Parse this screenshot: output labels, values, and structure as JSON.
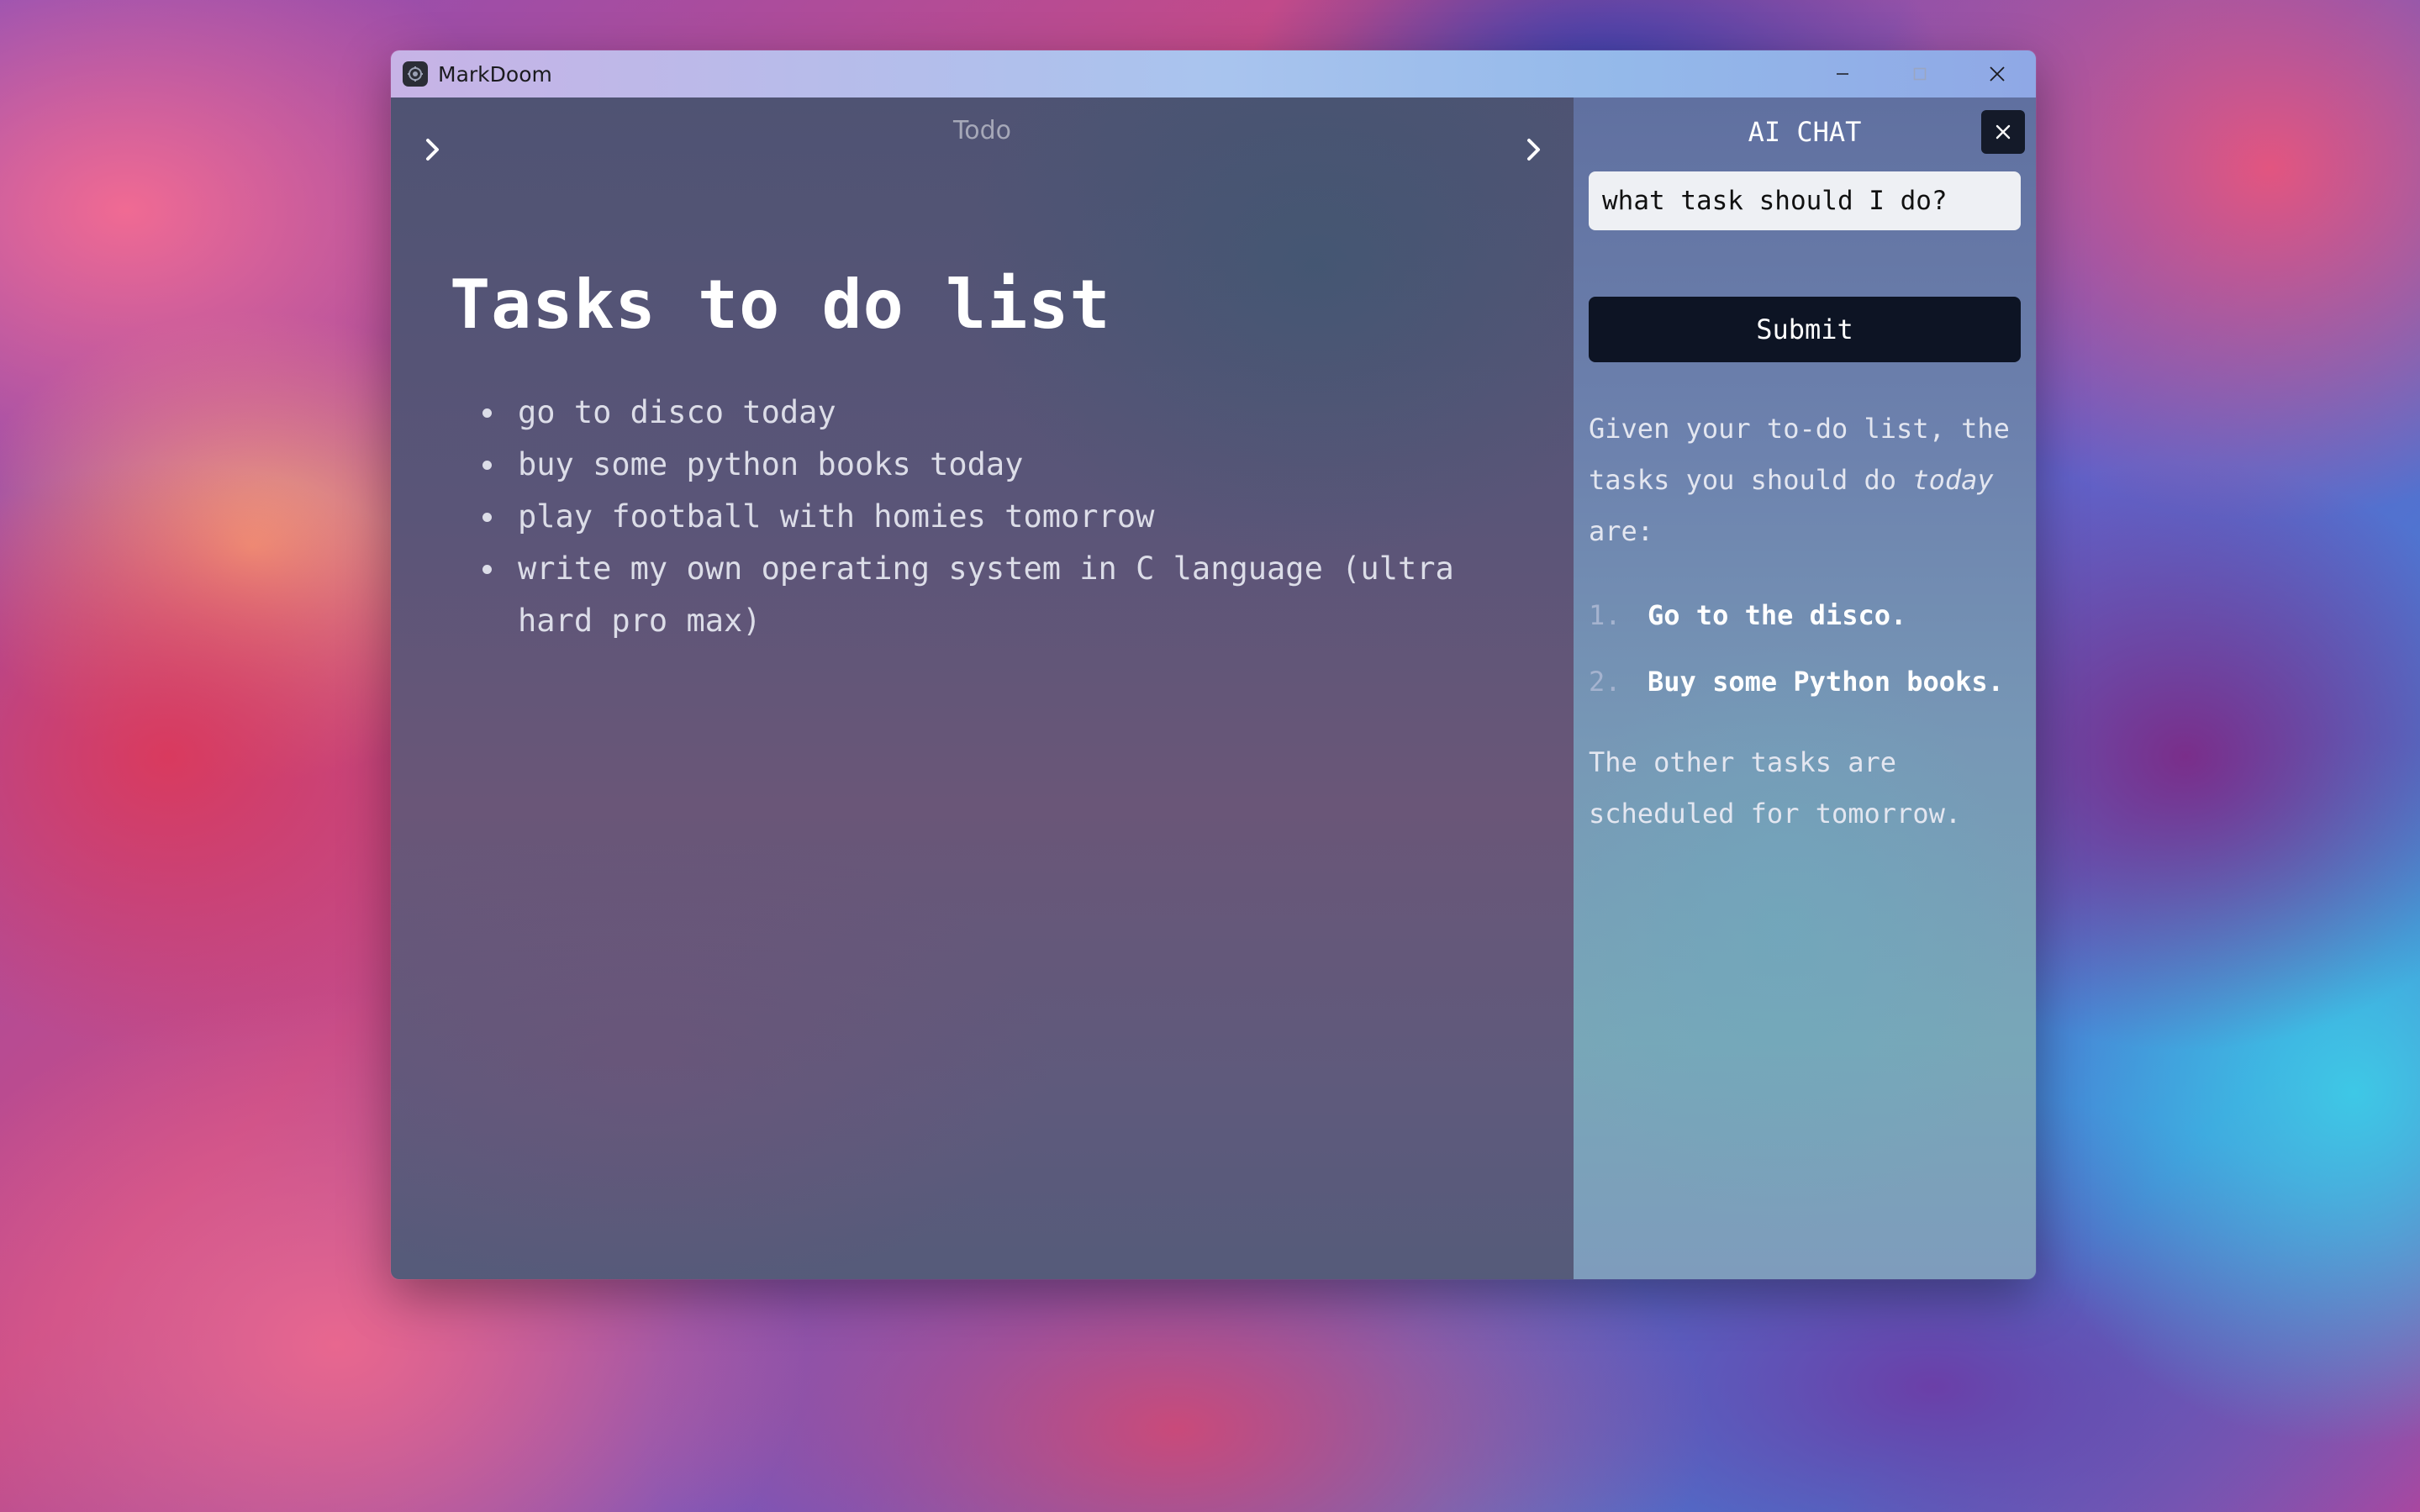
{
  "window": {
    "title": "MarkDoom",
    "controls": [
      "minimize",
      "maximize",
      "close"
    ]
  },
  "editor": {
    "doc_title": "Todo",
    "heading": "Tasks to do list",
    "items": [
      "go to disco today",
      "buy some python books today",
      "play football with homies tomorrow",
      "write my own operating system in C language (ultra hard pro max)"
    ]
  },
  "chat": {
    "header": "AI CHAT",
    "input_value": "what task should I do?",
    "submit_label": "Submit",
    "response": {
      "intro_before": "Given your to-do list, the tasks you should do ",
      "intro_emphasis": "today",
      "intro_after": " are:",
      "list": [
        {
          "number": "1.",
          "text": "Go to the disco."
        },
        {
          "number": "2.",
          "text": "Buy some Python books."
        }
      ],
      "outro": "The other tasks are scheduled for tomorrow."
    }
  },
  "icons": {
    "app": "markdoom-app-icon",
    "left_chevron": "chevron-right-icon",
    "right_chevron": "chevron-right-icon",
    "chat_close": "close-icon"
  },
  "colors": {
    "submit_bg": "#0d1424",
    "close_bg": "#141a29",
    "input_bg": "#eef0f4",
    "heading_text": "#ffffff"
  }
}
